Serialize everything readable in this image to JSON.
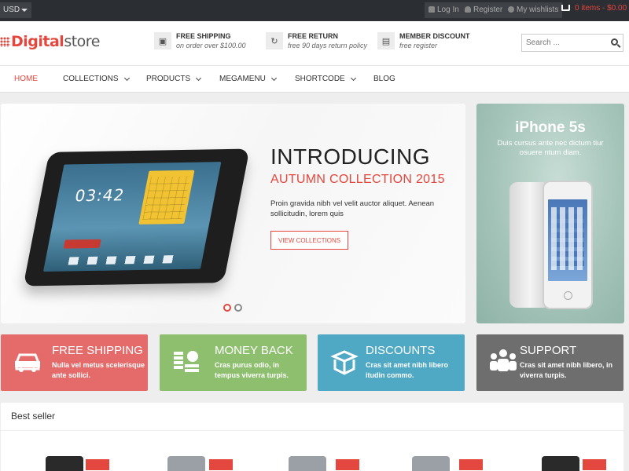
{
  "topbar": {
    "currency": "USD",
    "login": "Log In",
    "register": "Register",
    "wishlist": "My wishlists",
    "cart": "0 items - $0.00"
  },
  "header": {
    "logo_digital": "Digital",
    "logo_store": "store",
    "features": [
      {
        "title": "FREE SHIPPING",
        "subtitle": "on order over $100.00",
        "icon": "truck-icon"
      },
      {
        "title": "FREE RETURN",
        "subtitle": "free 90 days return policy",
        "icon": "refresh-icon"
      },
      {
        "title": "MEMBER DISCOUNT",
        "subtitle": "free register",
        "icon": "money-icon"
      }
    ],
    "search_placeholder": "Search ..."
  },
  "nav": {
    "items": [
      {
        "label": "HOME",
        "active": true
      },
      {
        "label": "COLLECTIONS"
      },
      {
        "label": "PRODUCTS"
      },
      {
        "label": "MEGAMENU"
      },
      {
        "label": "SHORTCODE"
      },
      {
        "label": "BLOG"
      }
    ]
  },
  "hero": {
    "title": "INTRODUCING",
    "subtitle": "AUTUMN COLLECTION 2015",
    "text": "Proin gravida nibh vel velit auctor aliquet. Aenean sollicitudin, lorem quis",
    "button": "VIEW COLLECTIONS",
    "tablet_clock": "03:42"
  },
  "promo": {
    "title": "iPhone 5s",
    "text": "Duis cursus ante nec dictum tiur osuere ntum diam."
  },
  "tiles": [
    {
      "title": "FREE SHIPPING",
      "text": "Nulla vel metus scelerisque ante sollici.",
      "color": "#e56b6b",
      "icon": "car-icon"
    },
    {
      "title": "MONEY BACK",
      "text": "Cras purus odio, in tempus viverra turpis.",
      "color": "#8dbf6f",
      "icon": "coins-icon"
    },
    {
      "title": "DISCOUNTS",
      "text": "Cras sit amet nibh libero itudin commo.",
      "color": "#4fa8c4",
      "icon": "box-icon"
    },
    {
      "title": "SUPPORT",
      "text": "Cras sit amet nibh libero, in viverra turpis.",
      "color": "#6e6e6e",
      "icon": "people-icon"
    }
  ],
  "bestseller": {
    "title": "Best seller"
  },
  "colors": {
    "accent": "#e4473d",
    "topbar": "#2b2e33"
  }
}
